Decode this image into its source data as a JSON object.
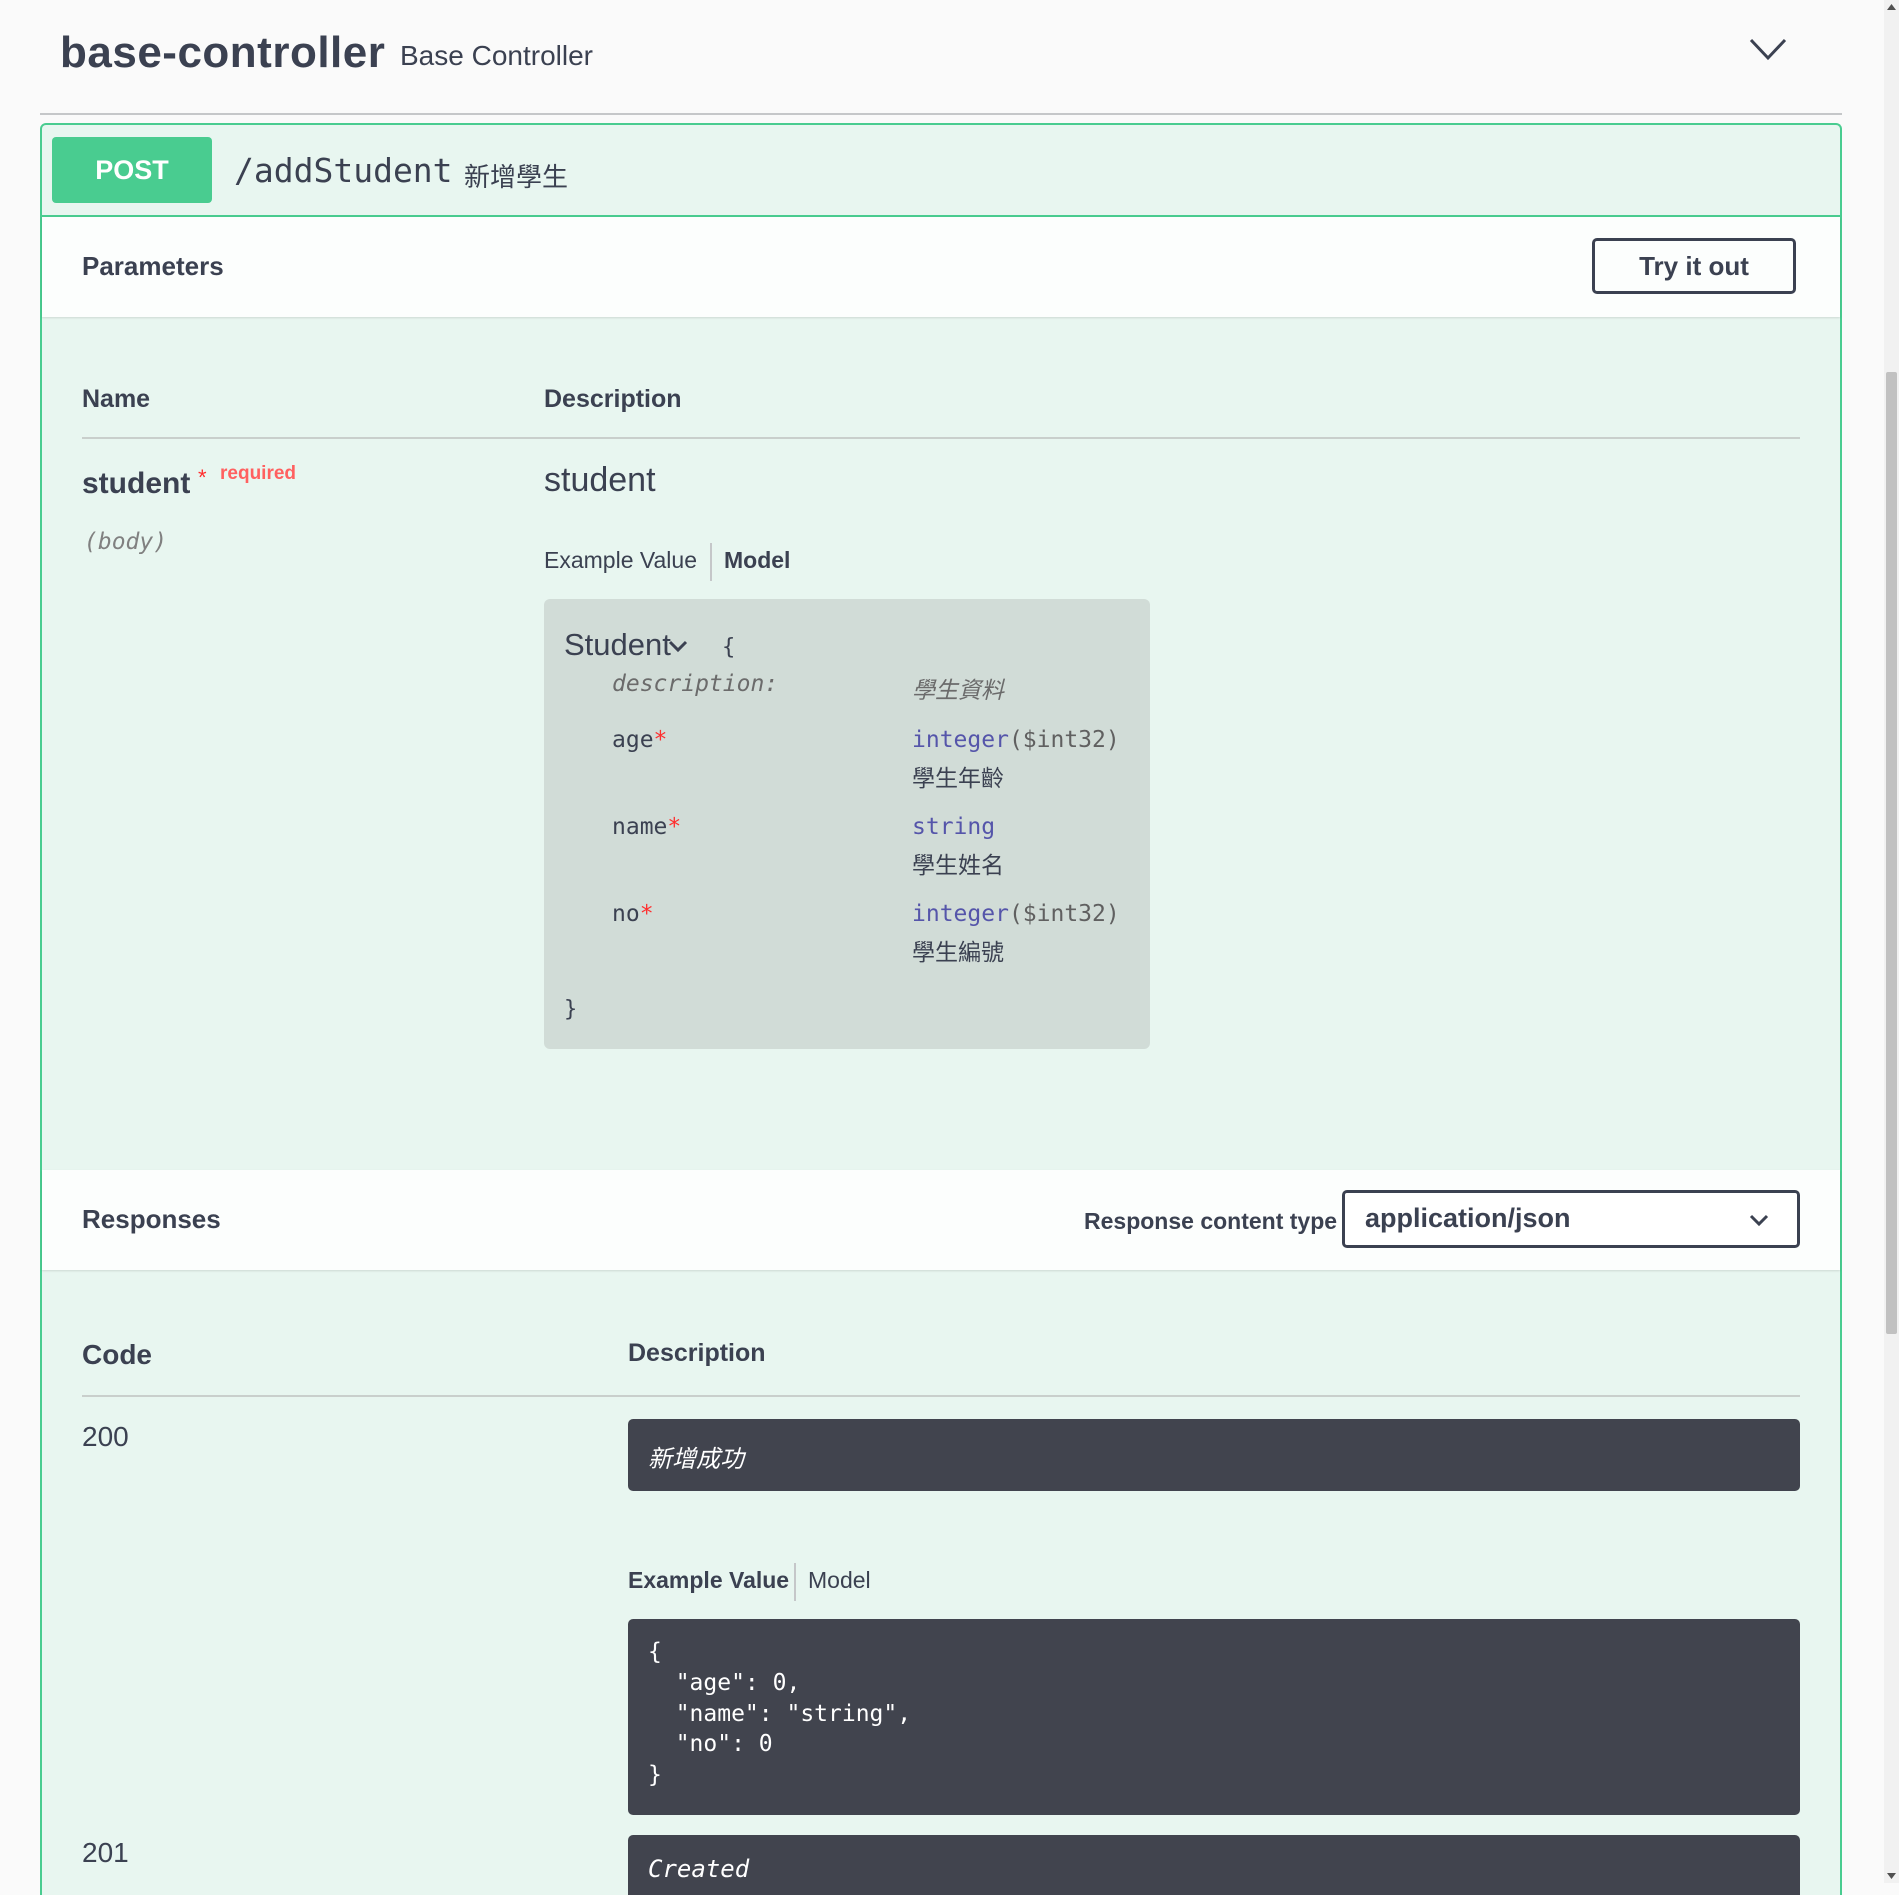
{
  "tag": {
    "name": "base-controller",
    "description": "Base Controller"
  },
  "operation": {
    "method": "POST",
    "path": "/addStudent",
    "summary": "新增學生",
    "method_color": "#49cc90"
  },
  "parameters": {
    "title": "Parameters",
    "try_label": "Try it out",
    "col_name": "Name",
    "col_description": "Description",
    "param": {
      "name": "student",
      "required_star": "*",
      "required_label": "required",
      "in": "(body)",
      "description": "student"
    },
    "tabs": {
      "example": "Example Value",
      "model": "Model"
    },
    "model": {
      "title": "Student",
      "open_brace": "{",
      "close_brace": "}",
      "description_key": "description:",
      "description_value": "學生資料",
      "properties": [
        {
          "key": "age",
          "type": "integer",
          "format": "($int32)",
          "description": "學生年齡"
        },
        {
          "key": "name",
          "type": "string",
          "format": "",
          "description": "學生姓名"
        },
        {
          "key": "no",
          "type": "integer",
          "format": "($int32)",
          "description": "學生編號"
        }
      ]
    }
  },
  "responses": {
    "title": "Responses",
    "content_type_label": "Response content type",
    "content_type_value": "application/json",
    "col_code": "Code",
    "col_description": "Description",
    "tabs": {
      "example": "Example Value",
      "model": "Model"
    },
    "items": [
      {
        "code": "200",
        "description": "新增成功",
        "example_lines": [
          "{",
          "  \"age\": 0,",
          "  \"name\": \"string\",",
          "  \"no\": 0",
          "}"
        ]
      },
      {
        "code": "201",
        "description": "Created"
      }
    ]
  }
}
